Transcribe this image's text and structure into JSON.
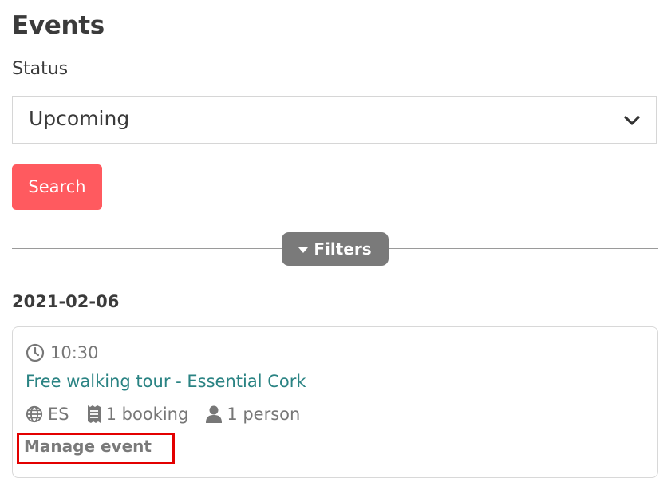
{
  "page": {
    "title": "Events"
  },
  "filters_form": {
    "status_label": "Status",
    "status_value": "Upcoming",
    "search_label": "Search",
    "filters_label": "Filters"
  },
  "events": {
    "date": "2021-02-06",
    "items": [
      {
        "time": "10:30",
        "title": "Free walking tour - Essential Cork",
        "language": "ES",
        "bookings": "1 booking",
        "people": "1 person",
        "manage_label": "Manage event"
      }
    ]
  },
  "colors": {
    "search_button": "#ff5a5f",
    "filters_button": "#7a7a7a",
    "event_link": "#2a8383",
    "highlight_box": "#e30000"
  },
  "icons": [
    "chevron-down-icon",
    "caret-down-icon",
    "clock-icon",
    "globe-icon",
    "receipt-icon",
    "user-icon"
  ]
}
